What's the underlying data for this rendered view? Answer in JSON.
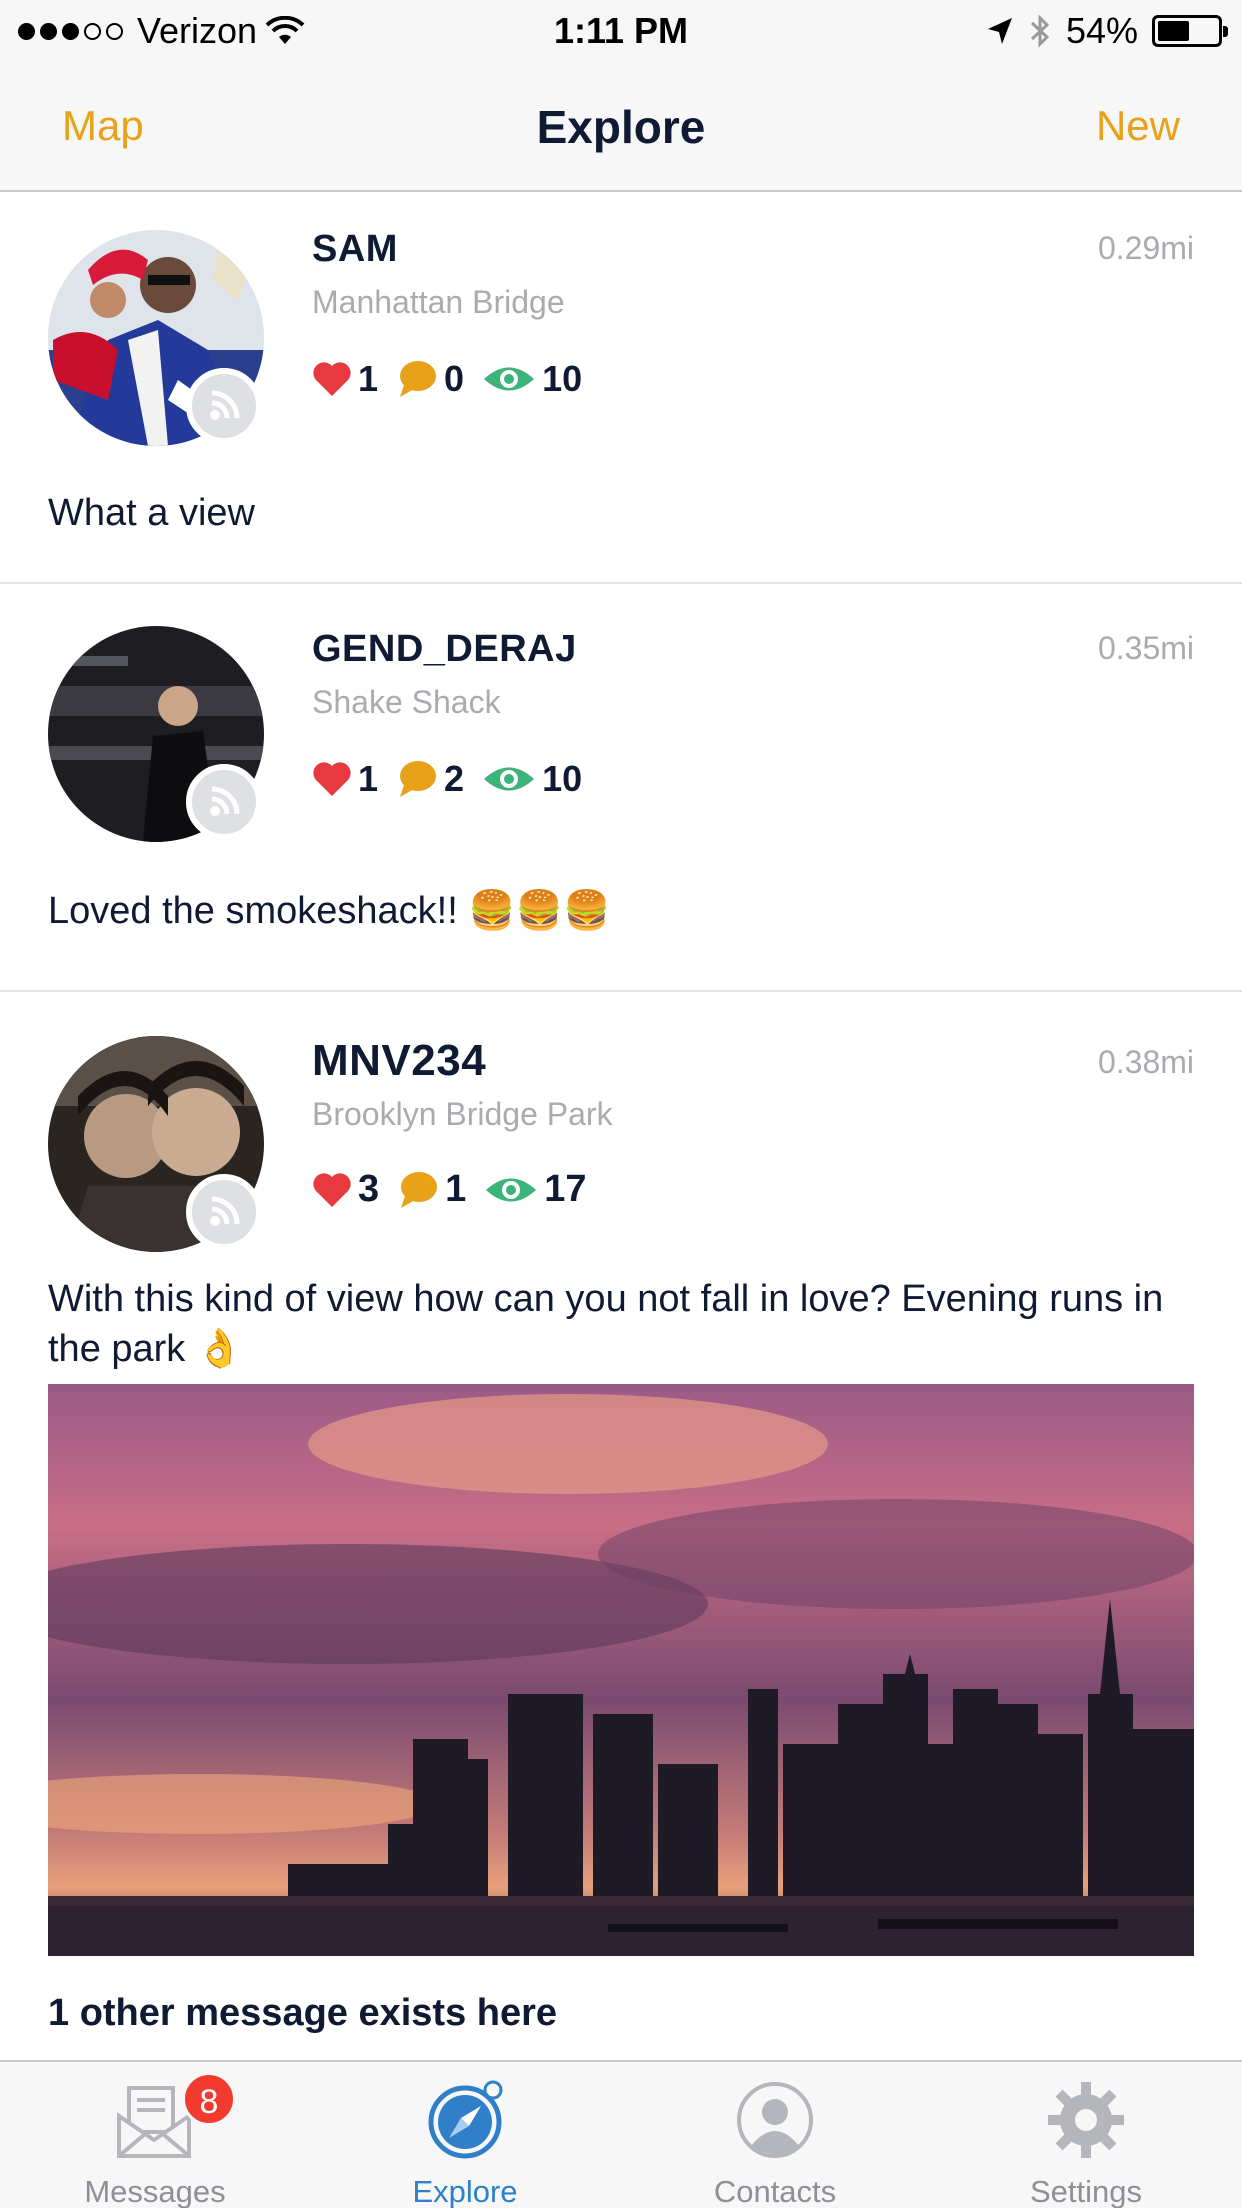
{
  "status_bar": {
    "carrier": "Verizon",
    "time": "1:11 PM",
    "battery": "54%",
    "battery_level": 0.54,
    "signal_bars": 3,
    "signal_total": 5
  },
  "nav": {
    "left": "Map",
    "title": "Explore",
    "right": "New",
    "accent_color": "#e8a21a"
  },
  "posts": [
    {
      "username": "SAM",
      "distance": "0.29mi",
      "place": "Manhattan Bridge",
      "likes": "1",
      "comments": "0",
      "views": "10",
      "message": "What a view"
    },
    {
      "username": "GEND_DERAJ",
      "distance": "0.35mi",
      "place": "Shake Shack",
      "likes": "1",
      "comments": "2",
      "views": "10",
      "message": "Loved the smokeshack!! 🍔🍔🍔"
    },
    {
      "username": "MNV234",
      "distance": "0.38mi",
      "place": "Brooklyn Bridge Park",
      "likes": "3",
      "comments": "1",
      "views": "17",
      "message": "With this kind of view how can you not fall in love? Evening runs in the park 👌",
      "other_messages": "1 other message exists here"
    }
  ],
  "tabs": [
    {
      "label": "Messages",
      "icon": "envelope-icon",
      "badge": "8"
    },
    {
      "label": "Explore",
      "icon": "compass-icon",
      "active": true
    },
    {
      "label": "Contacts",
      "icon": "person-icon"
    },
    {
      "label": "Settings",
      "icon": "gear-icon"
    }
  ],
  "colors": {
    "heart": "#e8393f",
    "comment": "#e8a21a",
    "views": "#3cb37a",
    "tab_active": "#2f80c8",
    "badge": "#f23a2f"
  }
}
